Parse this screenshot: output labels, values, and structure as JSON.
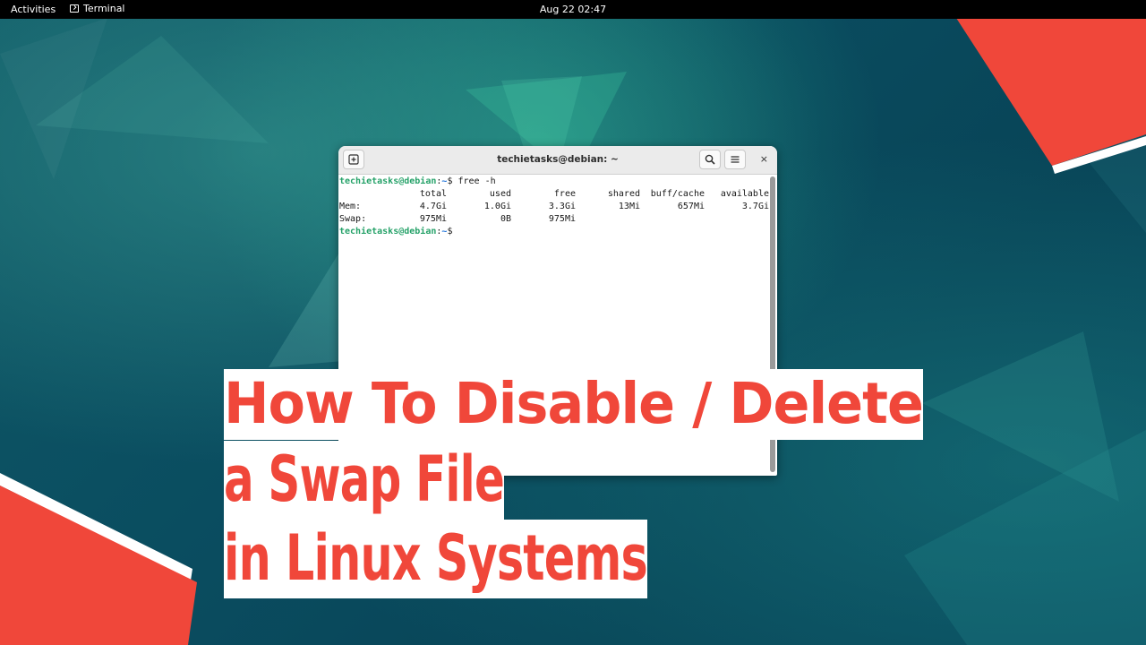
{
  "topbar": {
    "activities": "Activities",
    "app_name": "Terminal",
    "clock": "Aug 22  02:47"
  },
  "terminal": {
    "title": "techietasks@debian: ~",
    "new_tab_icon": "new-tab-icon",
    "search_icon": "search-icon",
    "menu_icon": "hamburger-menu-icon",
    "close_label": "×",
    "prompt_user": "techietasks@debian",
    "prompt_path": "~",
    "prompt_suffix": "$ ",
    "command": "free -h",
    "headers": [
      "",
      "total",
      "used",
      "free",
      "shared",
      "buff/cache",
      "available"
    ],
    "rows": [
      [
        "Mem:",
        "4.7Gi",
        "1.0Gi",
        "3.3Gi",
        "13Mi",
        "657Mi",
        "3.7Gi"
      ],
      [
        "Swap:",
        "975Mi",
        "0B",
        "975Mi",
        "",
        "",
        ""
      ]
    ]
  },
  "headline": {
    "line1": "How To Disable / Delete",
    "line2": "a Swap File",
    "line3": "in Linux Systems"
  },
  "colors": {
    "accent_red": "#f0473a",
    "prompt_green": "#26a269",
    "prompt_blue": "#1c71d8",
    "topbar": "#000000"
  }
}
